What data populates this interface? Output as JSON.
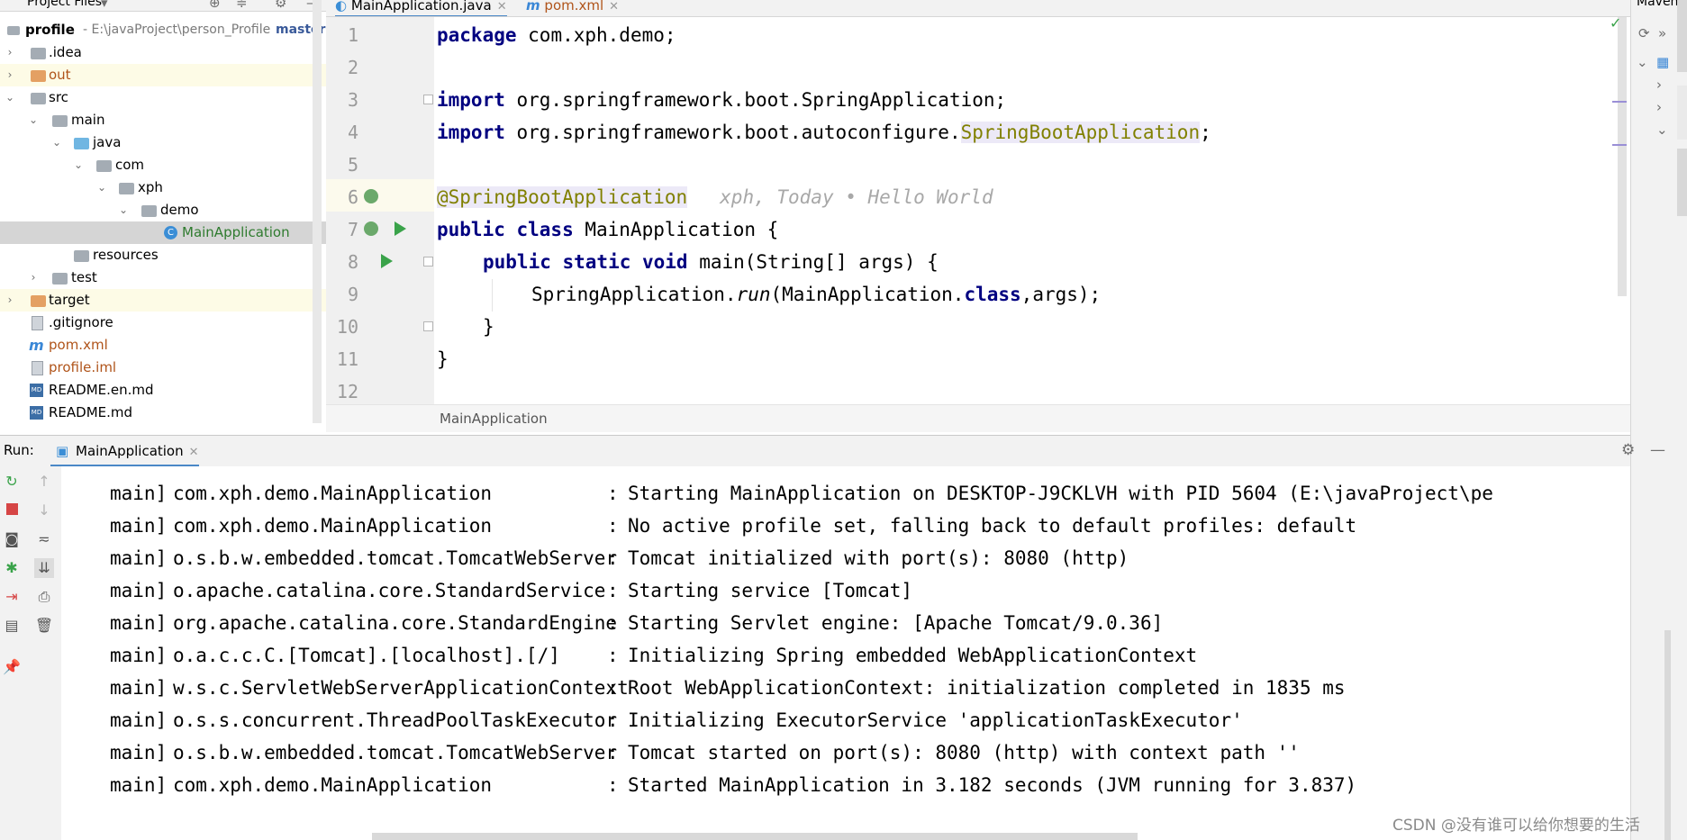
{
  "colors": {
    "keyword": "#000080",
    "annotation": "#808000",
    "excluded_folder": "#b0541a",
    "selected_class": "#2f7b2f",
    "run_green": "#3aa34a"
  },
  "project": {
    "header_label": "Project Files",
    "root_name": "profile",
    "root_path": "- E:\\javaProject\\person_Profile",
    "root_branch": "master",
    "tree": [
      {
        "label": ".idea"
      },
      {
        "label": "out"
      },
      {
        "label": "src"
      },
      {
        "label": "main"
      },
      {
        "label": "java"
      },
      {
        "label": "com"
      },
      {
        "label": "xph"
      },
      {
        "label": "demo"
      },
      {
        "label": "MainApplication"
      },
      {
        "label": "resources"
      },
      {
        "label": "test"
      },
      {
        "label": "target"
      },
      {
        "label": ".gitignore"
      },
      {
        "label": "pom.xml"
      },
      {
        "label": "profile.iml"
      },
      {
        "label": "README.en.md"
      },
      {
        "label": "README.md"
      }
    ]
  },
  "editor": {
    "tabs": [
      {
        "label": "MainApplication.java",
        "icon": "class-icon"
      },
      {
        "label": "pom.xml",
        "icon": "maven-icon"
      }
    ],
    "line_numbers": [
      "1",
      "2",
      "3",
      "4",
      "5",
      "6",
      "7",
      "8",
      "9",
      "10",
      "11",
      "12"
    ],
    "code": {
      "l1_kw": "package",
      "l1_rest": " com.xph.demo;",
      "l3_kw": "import",
      "l3_rest": " org.springframework.boot.SpringApplication;",
      "l4_kw": "import",
      "l4_pre": " org.springframework.boot.autoconfigure.",
      "l4_hl": "SpringBootApplication",
      "l4_end": ";",
      "l6_ann": "@SpringBootApplication",
      "l6_inlay": "xph, Today • Hello World",
      "l7_kw": "public class",
      "l7_rest": " MainApplication {",
      "l8_kw": "public static void",
      "l8_rest": " main(String[] args) {",
      "l9_pre": "SpringApplication.",
      "l9_run": "run",
      "l9_mid": "(MainApplication.",
      "l9_kw": "class",
      "l9_end": ",args);",
      "l10": "}",
      "l11": "}"
    },
    "breadcrumb": "MainApplication"
  },
  "right_strip": {
    "title": "Maven"
  },
  "run": {
    "label": "Run:",
    "tab_label": "MainApplication",
    "log": [
      {
        "thread": "main]",
        "logger": "com.xph.demo.MainApplication",
        "msg": "Starting MainApplication on DESKTOP-J9CKLVH with PID 5604 (E:\\javaProject\\pe"
      },
      {
        "thread": "main]",
        "logger": "com.xph.demo.MainApplication",
        "msg": "No active profile set, falling back to default profiles: default"
      },
      {
        "thread": "main]",
        "logger": "o.s.b.w.embedded.tomcat.TomcatWebServer",
        "msg": "Tomcat initialized with port(s): 8080 (http)"
      },
      {
        "thread": "main]",
        "logger": "o.apache.catalina.core.StandardService",
        "msg": "Starting service [Tomcat]"
      },
      {
        "thread": "main]",
        "logger": "org.apache.catalina.core.StandardEngine",
        "msg": "Starting Servlet engine: [Apache Tomcat/9.0.36]"
      },
      {
        "thread": "main]",
        "logger": "o.a.c.c.C.[Tomcat].[localhost].[/]",
        "msg": "Initializing Spring embedded WebApplicationContext"
      },
      {
        "thread": "main]",
        "logger": "w.s.c.ServletWebServerApplicationContext",
        "msg": "Root WebApplicationContext: initialization completed in 1835 ms"
      },
      {
        "thread": "main]",
        "logger": "o.s.s.concurrent.ThreadPoolTaskExecutor",
        "msg": "Initializing ExecutorService 'applicationTaskExecutor'"
      },
      {
        "thread": "main]",
        "logger": "o.s.b.w.embedded.tomcat.TomcatWebServer",
        "msg": "Tomcat started on port(s): 8080 (http) with context path ''"
      },
      {
        "thread": "main]",
        "logger": "com.xph.demo.MainApplication",
        "msg": "Started MainApplication in 3.182 seconds (JVM running for 3.837)"
      }
    ],
    "separator": ":"
  },
  "watermark": "CSDN @没有谁可以给你想要的生活"
}
